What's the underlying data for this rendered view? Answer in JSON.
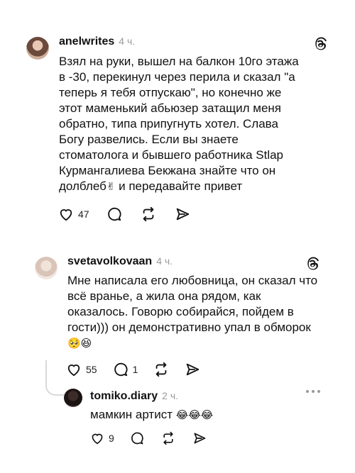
{
  "posts": [
    {
      "username": "anelwrites",
      "time": "4 ч.",
      "text": "Взял на руки, вышел на балкон 10го этажа в -30, перекинул через перила и сказал \"а теперь я тебя отпускаю\", но конечно же этот маменький абьюзер затащил меня обратно, типа припугнуть хотел. Слава Богу развелись. Если вы знаете стоматолога и бывшего работника Stlap Курмангалиева Бекжана знайте что он долблеб",
      "text_tail": " и передавайте привет",
      "emoji": "✌",
      "likes": "47"
    },
    {
      "username": "svetavolkovaan",
      "time": "4 ч.",
      "text": "Мне написала его любовница, он сказал что всё вранье, а жила она рядом, как оказалось. Говорю собирайся, пойдем в гости))) он демонстративно упал в обморок",
      "emoji": "🥺😆",
      "likes": "55",
      "replies": "1"
    },
    {
      "username": "tomiko.diary",
      "time": "2 ч.",
      "text": "мамкин артист",
      "emoji": "😂😂😂",
      "likes": "9"
    }
  ],
  "icons": {
    "like": "heart-icon",
    "reply": "comment-icon",
    "repost": "repost-icon",
    "share": "send-icon",
    "threads": "threads-logo-icon",
    "more": "more-icon"
  }
}
